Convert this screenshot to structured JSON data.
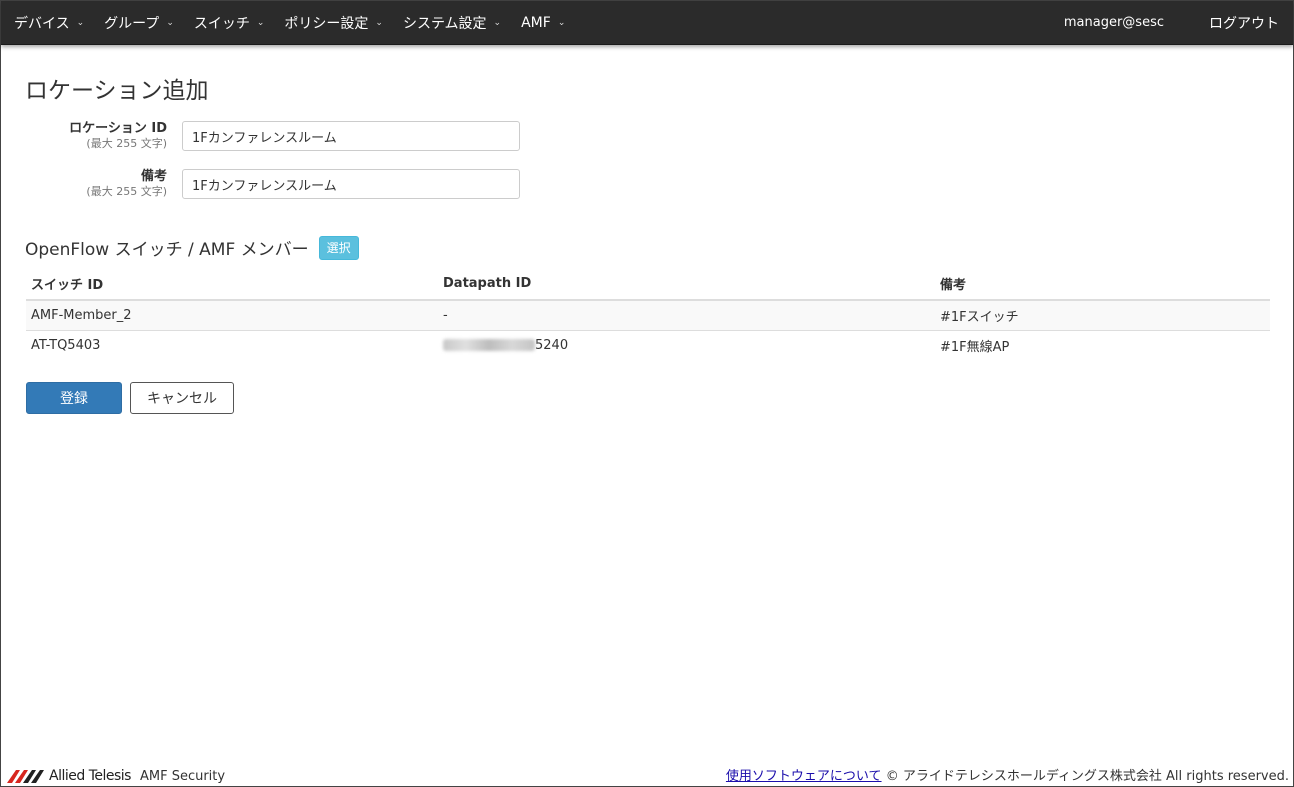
{
  "nav": {
    "items": [
      {
        "label": "デバイス"
      },
      {
        "label": "グループ"
      },
      {
        "label": "スイッチ"
      },
      {
        "label": "ポリシー設定"
      },
      {
        "label": "システム設定"
      },
      {
        "label": "AMF"
      }
    ],
    "user": "manager@sesc",
    "logout": "ログアウト"
  },
  "page": {
    "title": "ロケーション追加"
  },
  "form": {
    "location_id": {
      "label": "ロケーション ID",
      "hint": "(最大 255 文字)",
      "value": "1Fカンファレンスルーム"
    },
    "remarks": {
      "label": "備考",
      "hint": "(最大 255 文字)",
      "value": "1Fカンファレンスルーム"
    }
  },
  "section": {
    "title": "OpenFlow スイッチ / AMF メンバー",
    "select_button": "選択"
  },
  "table": {
    "headers": [
      "スイッチ ID",
      "Datapath ID",
      "備考"
    ],
    "rows": [
      {
        "switch_id": "AMF-Member_2",
        "datapath_id": "-",
        "remarks": "#1Fスイッチ"
      },
      {
        "switch_id": "AT-TQ5403",
        "datapath_id_suffix": "5240",
        "remarks": "#1F無線AP"
      }
    ]
  },
  "buttons": {
    "register": "登録",
    "cancel": "キャンセル"
  },
  "footer": {
    "brand": "Allied Telesis",
    "product": "AMF Security",
    "link": "使用ソフトウェアについて",
    "copyright": "© アライドテレシスホールディングス株式会社 All rights reserved.",
    "logo_color": "#d7261e"
  }
}
